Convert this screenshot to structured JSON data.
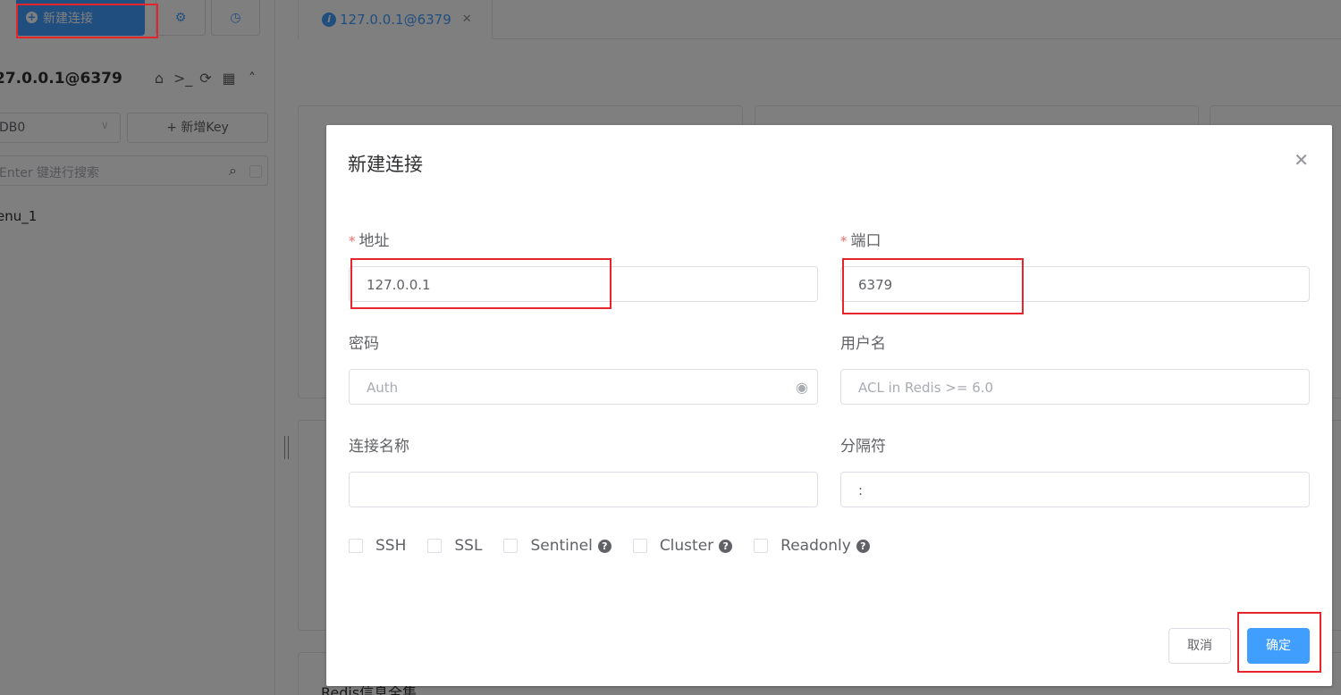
{
  "sidebar": {
    "new_connection_label": "新建连接",
    "connection_title": "27.0.0.1@6379",
    "db_select_value": "DB0",
    "add_key_label": "+ 新增Key",
    "search_placeholder": "Enter 键进行搜索",
    "key_items": [
      "enu_1"
    ]
  },
  "tabs": [
    {
      "label": "127.0.0.1@6379"
    }
  ],
  "background": {
    "card_title_partial": "Redis信息全集"
  },
  "dialog": {
    "title": "新建连接",
    "fields": {
      "address": {
        "label": "地址",
        "value": "127.0.0.1",
        "required": true
      },
      "port": {
        "label": "端口",
        "value": "6379",
        "required": true
      },
      "password": {
        "label": "密码",
        "placeholder": "Auth"
      },
      "username": {
        "label": "用户名",
        "placeholder": "ACL in Redis >= 6.0"
      },
      "conn_name": {
        "label": "连接名称",
        "value": ""
      },
      "separator": {
        "label": "分隔符",
        "value": ":"
      }
    },
    "checkboxes": [
      {
        "label": "SSH",
        "checked": false,
        "help": false
      },
      {
        "label": "SSL",
        "checked": false,
        "help": false
      },
      {
        "label": "Sentinel",
        "checked": false,
        "help": true
      },
      {
        "label": "Cluster",
        "checked": false,
        "help": true
      },
      {
        "label": "Readonly",
        "checked": false,
        "help": true
      }
    ],
    "cancel_label": "取消",
    "ok_label": "确定"
  },
  "colors": {
    "primary": "#409eff",
    "highlight": "#e4252b",
    "required": "#f56c6c"
  }
}
